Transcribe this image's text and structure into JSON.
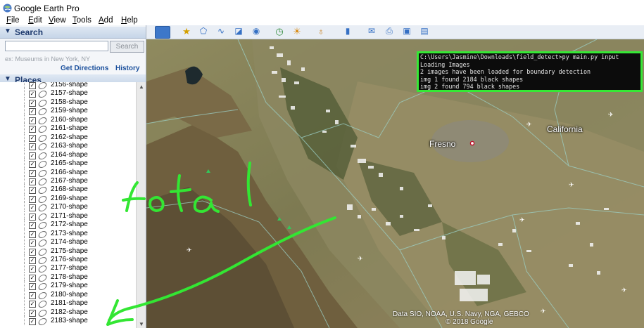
{
  "window": {
    "title": "Google Earth Pro"
  },
  "menu": [
    {
      "label": "File",
      "key": "F"
    },
    {
      "label": "Edit",
      "key": "E"
    },
    {
      "label": "View",
      "key": "V"
    },
    {
      "label": "Tools",
      "key": "T"
    },
    {
      "label": "Add",
      "key": "A"
    },
    {
      "label": "Help",
      "key": "H"
    }
  ],
  "search": {
    "header": "Search",
    "placeholder": "",
    "button": "Search",
    "hint": "ex: Museums in New York, NY",
    "get_directions": "Get Directions",
    "history": "History"
  },
  "places": {
    "header": "Places",
    "items": [
      "2156-shape",
      "2157-shape",
      "2158-shape",
      "2159-shape",
      "2160-shape",
      "2161-shape",
      "2162-shape",
      "2163-shape",
      "2164-shape",
      "2165-shape",
      "2166-shape",
      "2167-shape",
      "2168-shape",
      "2169-shape",
      "2170-shape",
      "2171-shape",
      "2172-shape",
      "2173-shape",
      "2174-shape",
      "2175-shape",
      "2176-shape",
      "2177-shape",
      "2178-shape",
      "2179-shape",
      "2180-shape",
      "2181-shape",
      "2182-shape",
      "2183-shape"
    ]
  },
  "terminal": {
    "lines": [
      "C:\\Users\\Jasmine\\Downloads\\field_detect>py main.py input",
      "Loading Images",
      "2 images have been loaded for boundary detection",
      "img 1 found 2184 black shapes",
      "img 2 found 794 black shapes"
    ]
  },
  "map": {
    "labels": {
      "city": "Fresno",
      "state": "California"
    },
    "attribution": [
      "Data SIO, NOAA, U.S. Navy, NGA, GEBCO",
      "© 2018 Google"
    ]
  },
  "annotation": {
    "text": "total",
    "color": "#33e633"
  },
  "colors": {
    "accent": "#35e835",
    "link": "#1a4f9c",
    "header_text": "#1e3a6e"
  }
}
